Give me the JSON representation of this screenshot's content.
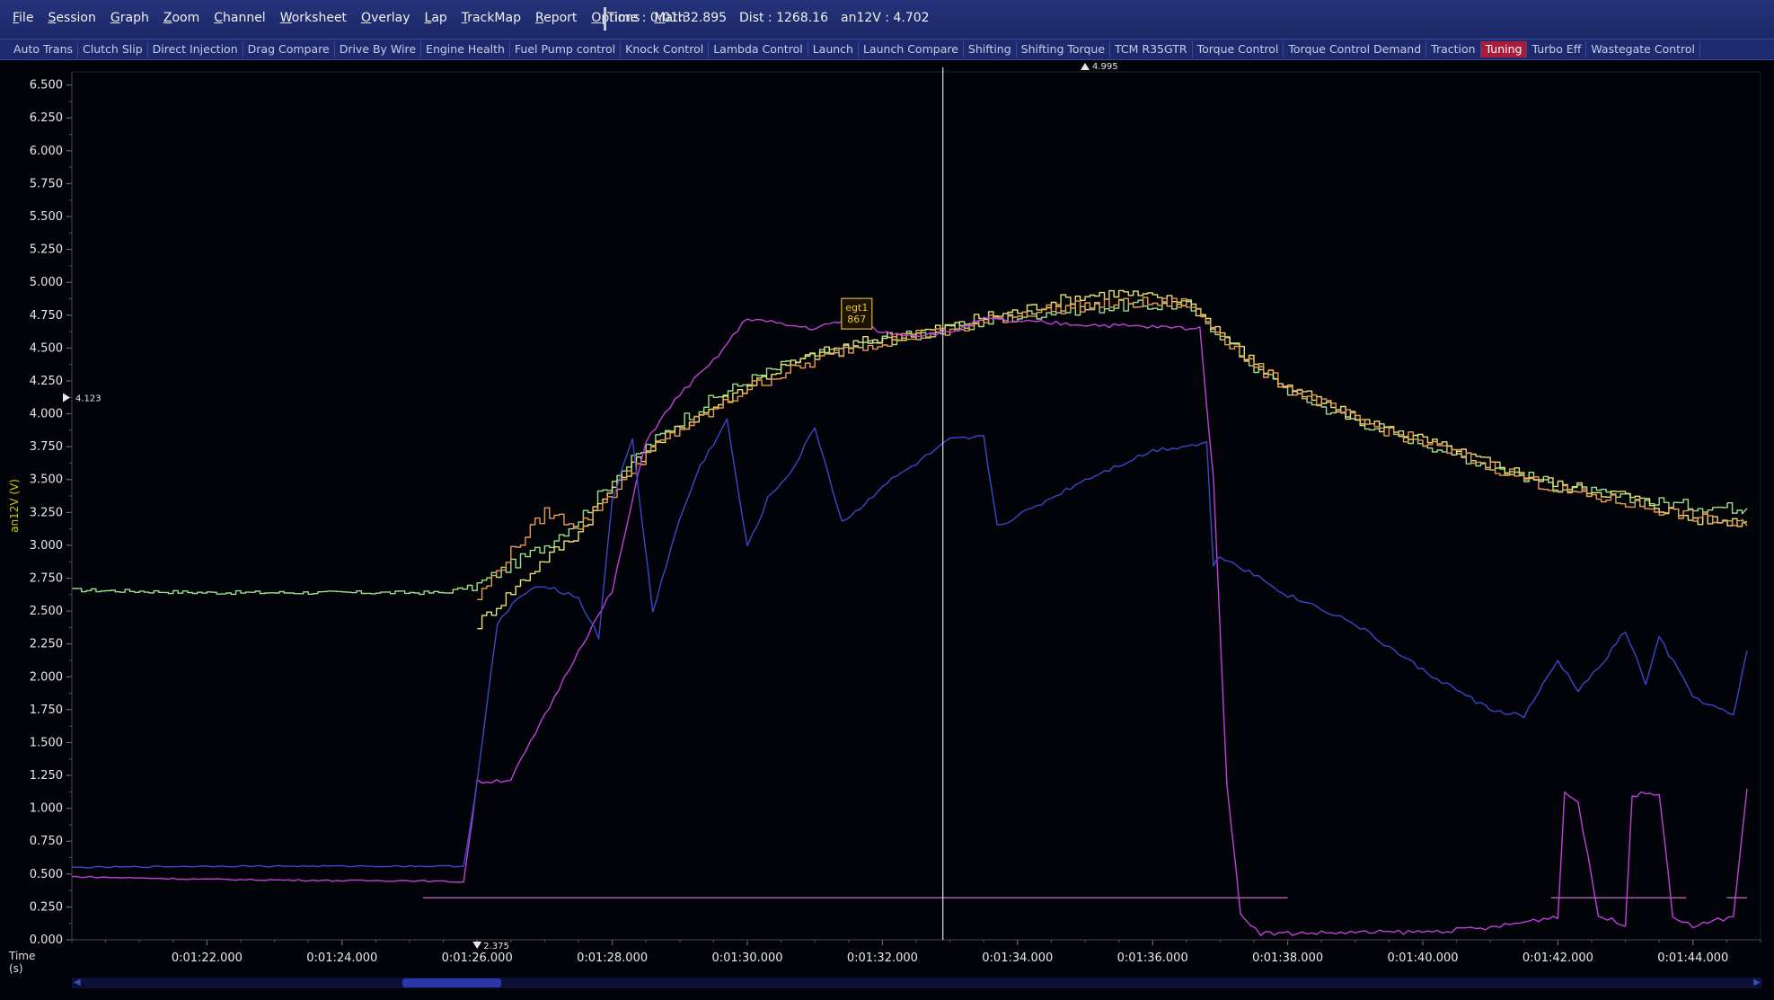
{
  "menu": {
    "items": [
      "File",
      "Session",
      "Graph",
      "Zoom",
      "Channel",
      "Worksheet",
      "Overlay",
      "Lap",
      "TrackMap",
      "Report",
      "Options",
      "Math"
    ]
  },
  "status": {
    "time": "Time : 0:01:32.895",
    "dist": "Dist : 1268.16",
    "channel": "an12V : 4.702"
  },
  "tabs": {
    "items": [
      "Auto Trans",
      "Clutch Slip",
      "Direct Injection",
      "Drag Compare",
      "Drive By Wire",
      "Engine Health",
      "Fuel Pump control",
      "Knock Control",
      "Lambda Control",
      "Launch",
      "Launch Compare",
      "Shifting",
      "Shifting Torque",
      "TCM R35GTR",
      "Torque Control",
      "Torque Control Demand",
      "Traction",
      "Tuning",
      "Turbo Eff",
      "Wastegate Control"
    ],
    "active": "Tuning"
  },
  "colors": {
    "magenta": "#c040d8",
    "blue": "#3a48c8",
    "green": "#9ae08a",
    "yellow": "#e6e070",
    "orange": "#e89a50",
    "axis": "#c8c800",
    "cursor": "#e0e0e0",
    "flat": "#e080e0"
  },
  "axes": {
    "ylabel": "an12V (V)",
    "xlabel_line1": "Time",
    "xlabel_line2": "(s)",
    "marker_left": "4.123",
    "marker_top": "4.995",
    "marker_bottom": "2.375",
    "tooltip_line1": "egt1",
    "tooltip_line2": "867"
  },
  "chart_data": {
    "type": "line",
    "ylabel": "an12V (V)",
    "xlabel": "Time (s)",
    "ylim": [
      0,
      6.6
    ],
    "xlim": [
      80.0,
      105.0
    ],
    "yticks": [
      "0.000",
      "0.250",
      "0.500",
      "0.750",
      "1.000",
      "1.250",
      "1.500",
      "1.750",
      "2.000",
      "2.250",
      "2.500",
      "2.750",
      "3.000",
      "3.250",
      "3.500",
      "3.750",
      "4.000",
      "4.250",
      "4.500",
      "4.750",
      "5.000",
      "5.250",
      "5.500",
      "5.750",
      "6.000",
      "6.250",
      "6.500"
    ],
    "xticks": [
      "0:01:22.000",
      "0:01:24.000",
      "0:01:26.000",
      "0:01:28.000",
      "0:01:30.000",
      "0:01:32.000",
      "0:01:34.000",
      "0:01:36.000",
      "0:01:38.000",
      "0:01:40.000",
      "0:01:42.000",
      "0:01:44.000"
    ],
    "xtick_values": [
      82,
      84,
      86,
      88,
      90,
      92,
      94,
      96,
      98,
      100,
      102,
      104
    ],
    "cursor_x": 92.895,
    "series": [
      {
        "color": "#9ae08a",
        "x": [
          80,
          82,
          84,
          85.5,
          86,
          86.5,
          87,
          87.5,
          88,
          88.5,
          89,
          89.5,
          90,
          90.5,
          91,
          91.5,
          92,
          92.5,
          93,
          93.5,
          94,
          94.5,
          95,
          95.5,
          96,
          96.5,
          97,
          97.5,
          98,
          98.5,
          99,
          100,
          101,
          102,
          103,
          104,
          104.8
        ],
        "y": [
          2.66,
          2.64,
          2.64,
          2.64,
          2.7,
          2.85,
          3.0,
          3.2,
          3.5,
          3.75,
          3.95,
          4.12,
          4.25,
          4.36,
          4.44,
          4.5,
          4.56,
          4.6,
          4.64,
          4.7,
          4.74,
          4.78,
          4.8,
          4.82,
          4.82,
          4.83,
          4.6,
          4.35,
          4.18,
          4.05,
          3.95,
          3.78,
          3.6,
          3.45,
          3.35,
          3.3,
          3.28
        ]
      },
      {
        "color": "#e6e070",
        "x": [
          86,
          86.5,
          87,
          87.5,
          88,
          88.5,
          89,
          89.5,
          90,
          90.5,
          91,
          91.5,
          92,
          92.5,
          93,
          93.5,
          94,
          94.5,
          95,
          95.5,
          96,
          96.5,
          97,
          97.5,
          98,
          98.5,
          99,
          100,
          101,
          102,
          103,
          104,
          104.8
        ],
        "y": [
          2.4,
          2.65,
          2.9,
          3.1,
          3.45,
          3.72,
          3.9,
          4.06,
          4.22,
          4.35,
          4.45,
          4.52,
          4.58,
          4.62,
          4.66,
          4.74,
          4.78,
          4.85,
          4.9,
          4.92,
          4.88,
          4.85,
          4.62,
          4.38,
          4.2,
          4.08,
          3.96,
          3.8,
          3.62,
          3.46,
          3.38,
          3.2,
          3.18
        ]
      },
      {
        "color": "#e89a50",
        "x": [
          86,
          86.5,
          87,
          87.5,
          88,
          88.5,
          89,
          89.5,
          90,
          90.5,
          91,
          91.5,
          92,
          92.5,
          93,
          93.5,
          94,
          94.5,
          95,
          95.5,
          96,
          96.5,
          97,
          97.5,
          98,
          98.5,
          99,
          100,
          101,
          102,
          103,
          104,
          104.8
        ],
        "y": [
          2.6,
          2.95,
          3.25,
          3.15,
          3.4,
          3.7,
          3.88,
          4.02,
          4.2,
          4.3,
          4.4,
          4.5,
          4.55,
          4.6,
          4.62,
          4.7,
          4.76,
          4.8,
          4.82,
          4.84,
          4.84,
          4.84,
          4.6,
          4.36,
          4.2,
          4.08,
          3.95,
          3.78,
          3.6,
          3.42,
          3.32,
          3.22,
          3.15
        ]
      },
      {
        "color": "#c040d8",
        "x": [
          80,
          82,
          84,
          85,
          85.8,
          86,
          86.5,
          87,
          87.5,
          88,
          88.5,
          89,
          89.5,
          90,
          90.5,
          91,
          91.5,
          92,
          92.5,
          93,
          93.5,
          94,
          95,
          96,
          96.7,
          96.9,
          97.1,
          97.3,
          97.6,
          98,
          100,
          101,
          102,
          102.1,
          102.3,
          102.6,
          103,
          103.1,
          103.5,
          103.7,
          104,
          104.6,
          104.8
        ],
        "y": [
          0.48,
          0.46,
          0.45,
          0.45,
          0.44,
          1.2,
          1.22,
          1.7,
          2.2,
          2.65,
          3.8,
          4.15,
          4.4,
          4.73,
          4.68,
          4.65,
          4.72,
          4.62,
          4.6,
          4.62,
          4.72,
          4.7,
          4.68,
          4.66,
          4.65,
          3.5,
          1.2,
          0.2,
          0.05,
          0.05,
          0.06,
          0.09,
          0.18,
          1.12,
          1.05,
          0.18,
          0.12,
          1.1,
          1.12,
          0.18,
          0.1,
          0.18,
          1.15
        ]
      },
      {
        "color": "#3a48c8",
        "x": [
          80,
          82,
          84,
          85.8,
          86,
          86.3,
          86.6,
          87,
          87.5,
          87.8,
          88,
          88.3,
          88.6,
          89,
          89.3,
          89.7,
          90,
          90.3,
          90.7,
          91,
          91.4,
          91.6,
          92,
          92.5,
          93,
          93.5,
          93.7,
          94,
          95,
          96,
          96.8,
          96.9,
          97,
          97.5,
          98,
          98.5,
          99,
          100,
          101,
          101.5,
          102,
          102.3,
          102.6,
          103,
          103.3,
          103.5,
          104,
          104.6,
          104.8
        ],
        "y": [
          0.55,
          0.56,
          0.56,
          0.56,
          1.2,
          2.4,
          2.6,
          2.7,
          2.6,
          2.3,
          3.35,
          3.8,
          2.5,
          3.2,
          3.6,
          3.95,
          2.98,
          3.35,
          3.6,
          3.9,
          3.18,
          3.25,
          3.45,
          3.62,
          3.8,
          3.82,
          3.15,
          3.22,
          3.5,
          3.72,
          3.78,
          2.85,
          2.92,
          2.78,
          2.62,
          2.52,
          2.4,
          2.05,
          1.75,
          1.7,
          2.12,
          1.9,
          2.06,
          2.35,
          1.95,
          2.3,
          1.85,
          1.7,
          2.2
        ]
      }
    ]
  }
}
